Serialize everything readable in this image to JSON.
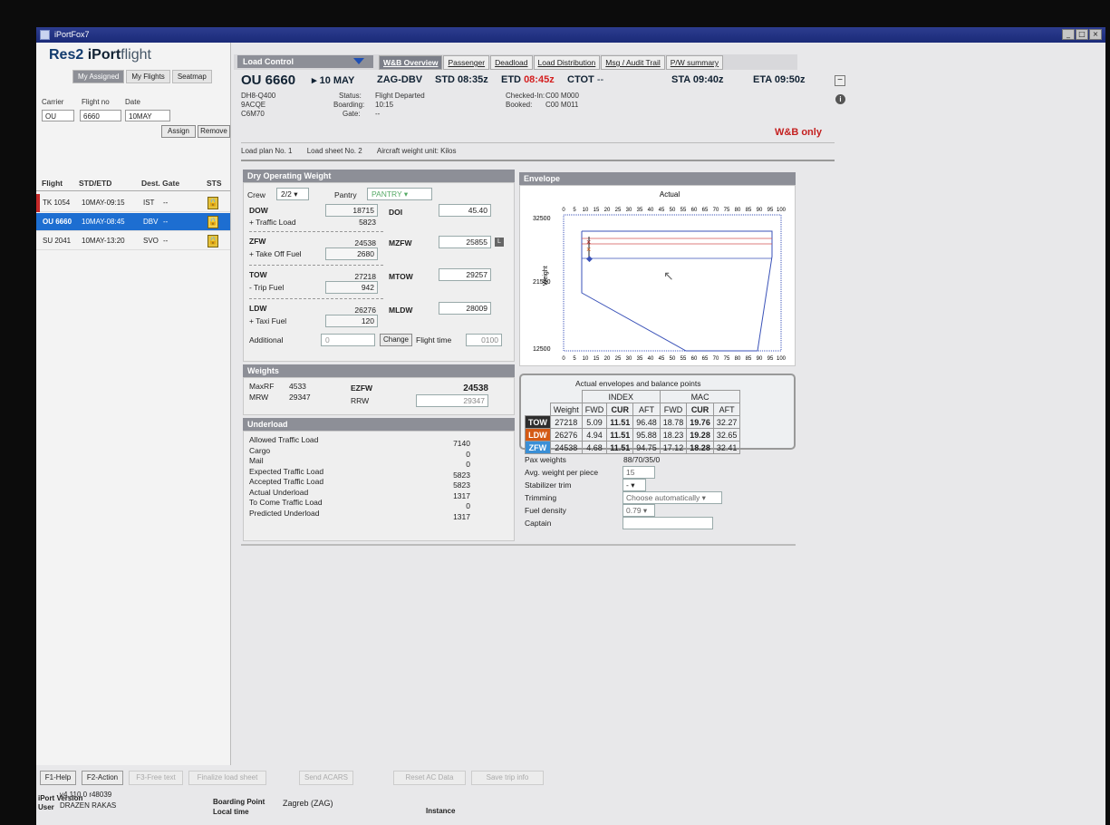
{
  "app": {
    "title": "iPortFox7",
    "logo": {
      "brand": "Res2",
      "product": "iPort",
      "suffix": "flight"
    }
  },
  "left": {
    "tabs": [
      "My Assigned",
      "My Flights",
      "Seatmap"
    ],
    "carrier_label": "Carrier",
    "flightno_label": "Flight no",
    "date_label": "Date",
    "carrier": "OU",
    "flightno": "6660",
    "date": "10MAY",
    "assign": "Assign",
    "remove": "Remove",
    "cols": {
      "flight": "Flight",
      "std": "STD/ETD",
      "dest": "Dest. Gate",
      "sts": "STS"
    },
    "rows": [
      {
        "flight": "TK 1054",
        "time": "10MAY-09:15",
        "dest": "IST",
        "gate": "--"
      },
      {
        "flight": "OU 6660",
        "time": "10MAY-08:45",
        "dest": "DBV",
        "gate": "--"
      },
      {
        "flight": "SU 2041",
        "time": "10MAY-13:20",
        "dest": "SVO",
        "gate": "--"
      }
    ]
  },
  "topbar": {
    "load_control": "Load Control",
    "tabs": [
      "W&B Overview",
      "Passenger",
      "Deadload",
      "Load Distribution",
      "Msg / Audit Trail",
      "P/W summary"
    ]
  },
  "header": {
    "flight": "OU 6660",
    "type": "DH8-Q400",
    "reg": "9ACQE",
    "config": "C6M70",
    "date": "10 MAY",
    "route": "ZAG-DBV",
    "std": "STD 08:35z",
    "etd_label": "ETD",
    "etd": "08:45z",
    "ctot_label": "CTOT",
    "ctot": "--",
    "sta": "STA 09:40z",
    "eta": "ETA 09:50z",
    "status_label": "Status:",
    "status": "Flight Departed",
    "boarding_label": "Boarding:",
    "boarding": "10:15",
    "gate_label": "Gate:",
    "gate": "--",
    "checkedin_label": "Checked-In:",
    "checkedin": "C00 M000",
    "booked_label": "Booked:",
    "booked": "C00 M011",
    "wb_only": "W&B only"
  },
  "loadplan": {
    "lp": "Load plan No. 1",
    "ls": "Load sheet No. 2",
    "unit": "Aircraft weight unit: Kilos"
  },
  "dow": {
    "title": "Dry Operating Weight",
    "crew_label": "Crew",
    "crew": "2/2",
    "pantry_label": "Pantry",
    "pantry": "PANTRY",
    "dow_label": "DOW",
    "dow": "18715",
    "doi_label": "DOI",
    "doi": "45.40",
    "traffic_label": "+ Traffic Load",
    "traffic": "5823",
    "zfw_label": "ZFW",
    "zfw": "24538",
    "mzfw_label": "MZFW",
    "mzfw": "25855",
    "mzfw_badge": "L",
    "tof_label": "+ Take Off Fuel",
    "tof": "2680",
    "tow_label": "TOW",
    "tow": "27218",
    "mtow_label": "MTOW",
    "mtow": "29257",
    "trip_label": "- Trip Fuel",
    "trip": "942",
    "ldw_label": "LDW",
    "ldw": "26276",
    "mldw_label": "MLDW",
    "mldw": "28009",
    "taxi_label": "+ Taxi Fuel",
    "taxi": "120",
    "add_label": "Additional",
    "add": "0",
    "change": "Change",
    "ft_label": "Flight time",
    "ft": "0100"
  },
  "weights": {
    "title": "Weights",
    "maxrf_label": "MaxRF",
    "maxrf": "4533",
    "mrw_label": "MRW",
    "mrw": "29347",
    "ezfw_label": "EZFW",
    "ezfw": "24538",
    "rrw_label": "RRW",
    "rrw": "29347"
  },
  "underload": {
    "title": "Underload",
    "rows": [
      {
        "label": "Allowed Traffic Load",
        "value": "7140"
      },
      {
        "label": "Cargo",
        "value": "0"
      },
      {
        "label": "Mail",
        "value": "0"
      },
      {
        "label": "Expected Traffic Load",
        "value": "5823"
      },
      {
        "label": "Accepted Traffic Load",
        "value": "5823"
      },
      {
        "label": "Actual Underload",
        "value": "1317"
      },
      {
        "label": "To Come Traffic Load",
        "value": "0"
      },
      {
        "label": "Predicted Underload",
        "value": "1317"
      }
    ]
  },
  "envelope": {
    "title": "Envelope",
    "actual": "Actual",
    "ylabel": "Weight",
    "xticks": [
      "0",
      "5",
      "10",
      "15",
      "20",
      "25",
      "30",
      "35",
      "40",
      "45",
      "50",
      "55",
      "60",
      "65",
      "70",
      "75",
      "80",
      "85",
      "90",
      "95",
      "100"
    ],
    "yticks": [
      "32500",
      "21500",
      "12500"
    ]
  },
  "balance": {
    "title": "Actual envelopes and balance points",
    "index": "INDEX",
    "mac": "MAC",
    "weight": "Weight",
    "fwd": "FWD",
    "cur": "CUR",
    "aft": "AFT",
    "rows": [
      {
        "tag": "TOW",
        "w": "27218",
        "ifwd": "5.09",
        "icur": "11.51",
        "iaft": "96.48",
        "mfwd": "18.78",
        "mcur": "19.76",
        "maft": "32.27",
        "color": "#2d2d2d"
      },
      {
        "tag": "LDW",
        "w": "26276",
        "ifwd": "4.94",
        "icur": "11.51",
        "iaft": "95.88",
        "mfwd": "18.23",
        "mcur": "19.28",
        "maft": "32.65",
        "color": "#d45a15"
      },
      {
        "tag": "ZFW",
        "w": "24538",
        "ifwd": "4.68",
        "icur": "11.51",
        "iaft": "94.75",
        "mfwd": "17.12",
        "mcur": "18.28",
        "maft": "32.41",
        "color": "#3a8fd6"
      }
    ],
    "pax_label": "Pax weights",
    "pax": "88/70/35/0",
    "avg_label": "Avg. weight per piece",
    "avg": "15",
    "stab_label": "Stabilizer trim",
    "stab": "-",
    "trim_label": "Trimming",
    "trim": "Choose automatically",
    "fuel_label": "Fuel density",
    "fuel": "0.79",
    "captain_label": "Captain"
  },
  "footer": {
    "fkeys": [
      "F1-Help",
      "F2-Action",
      "F3-Free text",
      "Finalize load sheet",
      "Send ACARS",
      "Reset AC Data",
      "Save trip info"
    ],
    "iport_version_label": "iPort Version",
    "version": "v4.110.0 r48039",
    "user_label": "User",
    "user": "DRAZEN RAKAS",
    "bp_label": "Boarding Point",
    "bp": "Zagreb (ZAG)",
    "local_label": "Local time",
    "instance_label": "Instance"
  }
}
